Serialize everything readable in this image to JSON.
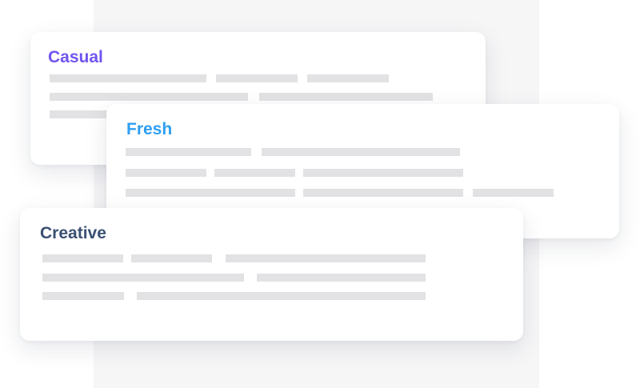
{
  "cards": {
    "casual": {
      "title": "Casual",
      "title_color": "#7154f0"
    },
    "fresh": {
      "title": "Fresh",
      "title_color": "#2e9ef2"
    },
    "creative": {
      "title": "Creative",
      "title_color": "#3a5072"
    }
  },
  "colors": {
    "placeholder_bar": "#e2e2e4",
    "backdrop": "#f6f6f7",
    "card_background": "#ffffff"
  }
}
